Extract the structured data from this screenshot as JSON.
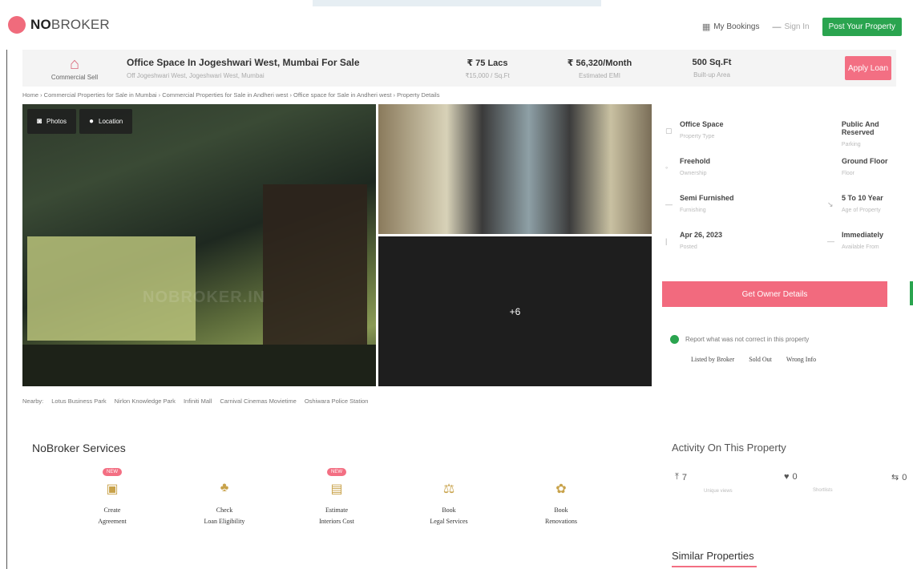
{
  "header": {
    "logo_bold": "NO",
    "logo_rest": "BROKER",
    "bookings_label": "My Bookings",
    "signin_label": "Sign In",
    "post_button": "Post Your Property"
  },
  "summary": {
    "category_label": "Commercial Sell",
    "title": "Office Space In Jogeshwari West, Mumbai For Sale",
    "subtitle": "Off Jogeshwari West, Jogeshwari West, Mumbai",
    "price": "₹ 75 Lacs",
    "price_sub": "₹15,000 / Sq.Ft",
    "emi": "₹ 56,320/Month",
    "emi_sub": "Estimated EMI",
    "area": "500 Sq.Ft",
    "area_sub": "Built-up Area",
    "loan_button": "Apply Loan"
  },
  "breadcrumb": "Home › Commercial Properties for Sale in Mumbai › Commercial Properties for Sale in Andheri west › Office space for Sale in Andheri west › Property Details",
  "gallery": {
    "photos_tab": "Photos",
    "location_tab": "Location",
    "watermark": "NOBROKER.IN",
    "more_count": "+6"
  },
  "nearby": {
    "label": "Nearby:",
    "places": [
      "Lotus Business Park",
      "Nirlon Knowledge Park",
      "Infiniti Mall",
      "Carnival Cinemas Movietime",
      "Oshiwara Police Station"
    ]
  },
  "details": [
    {
      "value": "Office Space",
      "label": "Property Type"
    },
    {
      "value": "Public And Reserved",
      "label": "Parking"
    },
    {
      "value": "Freehold",
      "label": "Ownership"
    },
    {
      "value": "Ground Floor",
      "label": "Floor"
    },
    {
      "value": "Semi Furnished",
      "label": "Furnishing"
    },
    {
      "value": "5 To 10 Year",
      "label": "Age of Property"
    },
    {
      "value": "Apr 26, 2023",
      "label": "Posted"
    },
    {
      "value": "Immediately",
      "label": "Available From"
    }
  ],
  "owner_button": "Get Owner Details",
  "report": {
    "text": "Report what was not correct in this property",
    "options": [
      "Listed by Broker",
      "Sold Out",
      "Wrong Info"
    ]
  },
  "services": {
    "title": "NoBroker Services",
    "items": [
      {
        "line1": "Create",
        "line2": "Agreement",
        "badge": "NEW"
      },
      {
        "line1": "Check",
        "line2": "Loan Eligibility",
        "badge": ""
      },
      {
        "line1": "Estimate",
        "line2": "Interiors Cost",
        "badge": "NEW"
      },
      {
        "line1": "Book",
        "line2": "Legal Services",
        "badge": ""
      },
      {
        "line1": "Book",
        "line2": "Renovations",
        "badge": ""
      }
    ]
  },
  "activity": {
    "title": "Activity On This Property",
    "unique_views": "7",
    "unique_views_label": "Unique views",
    "shortlists": "0",
    "shortlists_label": "Shortlists",
    "contacted": "0"
  },
  "similar_title": "Similar Properties"
}
